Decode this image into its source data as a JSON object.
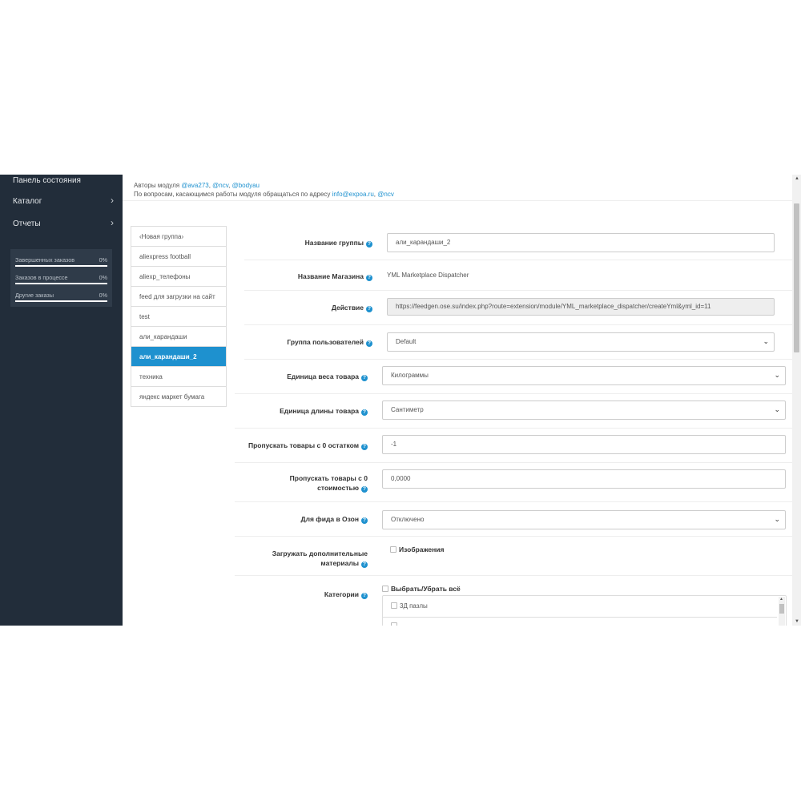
{
  "sidebar": {
    "nav": [
      {
        "label": "Панель состояния",
        "has_arrow": false
      },
      {
        "label": "Каталог",
        "has_arrow": true
      },
      {
        "label": "Отчеты",
        "has_arrow": true
      }
    ],
    "arrow_glyph": "›",
    "stats": [
      {
        "label": "Завершенных заказов",
        "value": "0%",
        "progress": 0
      },
      {
        "label": "Заказов в процессе",
        "value": "0%",
        "progress": 0
      },
      {
        "label": "Другие заказы",
        "value": "0%",
        "progress": 0
      }
    ]
  },
  "authors": {
    "line1_prefix": "Авторы модуля ",
    "authors": [
      "@ava273",
      "@ncv",
      "@bodyau"
    ],
    "separator": ", ",
    "line2_prefix": "По вопросам, касающимся работы модуля обращаться по адресу ",
    "email": "info@expoa.ru",
    "contact": "@ncv"
  },
  "groups": [
    {
      "label": "‹Новая группа›",
      "active": false
    },
    {
      "label": "aliexpress football",
      "active": false
    },
    {
      "label": "aliexp_телефоны",
      "active": false
    },
    {
      "label": "feed для загрузки на сайт",
      "active": false
    },
    {
      "label": "test",
      "active": false
    },
    {
      "label": "али_карандаши",
      "active": false
    },
    {
      "label": "али_карандаши_2",
      "active": true
    },
    {
      "label": "техника",
      "active": false
    },
    {
      "label": "яндекс маркет бумага",
      "active": false
    }
  ],
  "form": {
    "help_glyph": "?",
    "select_chevron": "⌄",
    "group_name": {
      "label": "Название группы",
      "value": "али_карандаши_2"
    },
    "store_name": {
      "label": "Название Магазина",
      "value": "YML Marketplace Dispatcher"
    },
    "action": {
      "label": "Действие",
      "value": "https://feedgen.ose.su/index.php?route=extension/module/YML_marketplace_dispatcher/createYml&yml_id=11"
    },
    "customer_group": {
      "label": "Группа пользователей",
      "value": "Default"
    },
    "weight_unit": {
      "label": "Единица веса товара",
      "value": "Килограммы"
    },
    "length_unit": {
      "label": "Единица длины товара",
      "value": "Сантиметр"
    },
    "skip_zero_stock": {
      "label": "Пропускать товары с 0 остатком",
      "value": "-1"
    },
    "skip_zero_price": {
      "label": "Пропускать товары с 0 стоимостью",
      "value": "0,0000"
    },
    "ozon_feed": {
      "label": "Для фида в Озон",
      "value": "Отключено"
    },
    "extra_materials": {
      "label": "Загружать дополнительные материалы",
      "option": "Изображения",
      "checked": false
    },
    "categories": {
      "label": "Категории",
      "select_all": "Выбрать/Убрать всё",
      "items": [
        "3Д пазлы"
      ]
    }
  }
}
